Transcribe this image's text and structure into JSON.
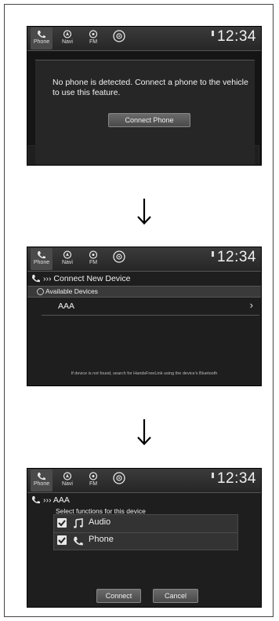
{
  "nav": {
    "phone_label": "Phone",
    "navi_label": "Navi",
    "fm_label": "FM",
    "app_icon": "audio-source-icon"
  },
  "clock": "12:34",
  "screen1": {
    "message": "No phone is detected. Connect a phone to the vehicle to use this feature.",
    "connect_button": "Connect Phone"
  },
  "screen2": {
    "title": "Connect New Device",
    "subhead": "Available Devices",
    "device": "AAA",
    "hint": "If device is not found, search for HandsFreeLink using the device's Bluetooth"
  },
  "screen3": {
    "title": "AAA",
    "select_label": "Select functions for this device",
    "functions": [
      "Audio",
      "Phone"
    ],
    "connect_button": "Connect",
    "cancel_button": "Cancel"
  },
  "icons": {
    "phone": "phone-icon",
    "arrow": "arrow-down-icon",
    "music": "music-note-icon",
    "chevron": "chevron-right-icon"
  }
}
